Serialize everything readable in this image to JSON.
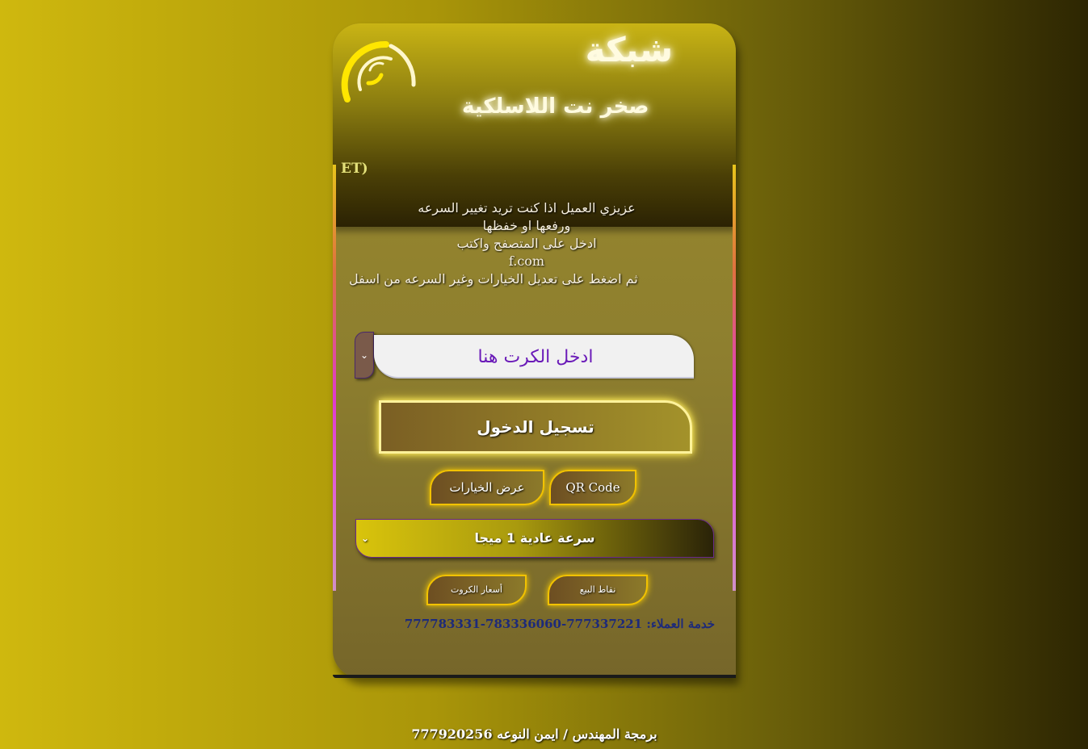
{
  "brand": {
    "title": "شبكة",
    "subtitle": "صخر نت اللاسلكية",
    "partial_text": "ET)"
  },
  "message": {
    "line1": "عزيزي العميل اذا كنت تريد تغيير السرعه",
    "line2": "ورفعها او خفظها",
    "line3": "ادخل على المتصفح واكتب",
    "line4": "f.com",
    "line5": "ثم اضغط على تعديل الخيارات وغير السرعه من اسفل"
  },
  "login_form": {
    "card_input_placeholder": "ادخل الكرت هنا",
    "login_button": "تسجيل الدخول",
    "options_button": "عرض الخيارات",
    "qr_button": "QR Code",
    "speed_selected": "سرعة عادية 1 ميجا",
    "prices_button": "أسعار الكروت",
    "points_of_sale_button": "نقاط البيع"
  },
  "support": {
    "text": "خدمة العملاء: 777337221-783336060-777783331"
  },
  "footer": {
    "credit": "برمجة المهندس / ايمن النوعه 777920256"
  },
  "icons": {
    "wifi": "wifi-icon",
    "chevron": "chevron-down-icon"
  },
  "colors": {
    "accent_yellow": "#ffe600",
    "input_text": "#6a1ab8",
    "support_text": "#1d2a7a"
  }
}
